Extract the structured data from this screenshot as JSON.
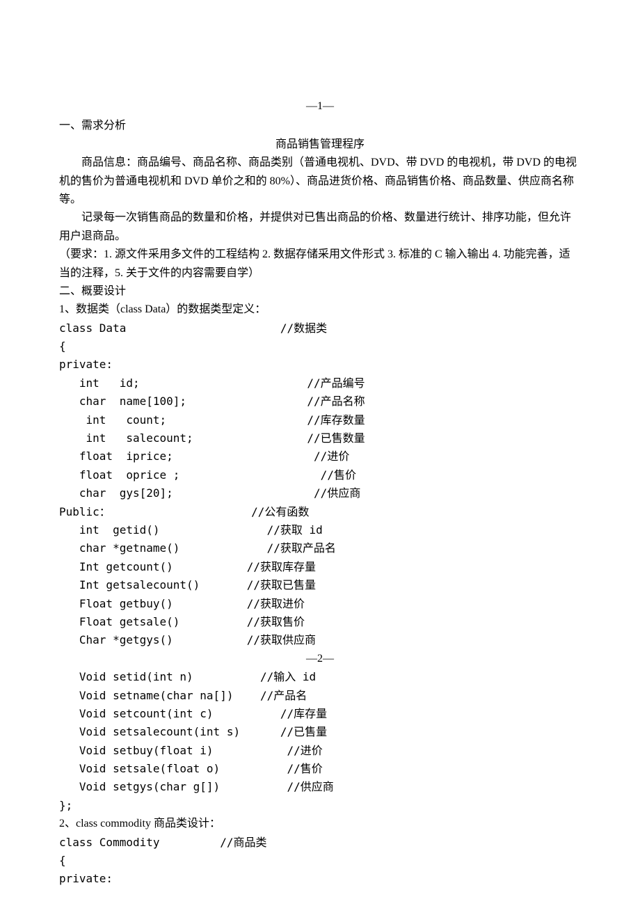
{
  "pageNumTop": "—1—",
  "pageNumMid": "—2—",
  "heading1": "一、需求分析",
  "title": "商品销售管理程序",
  "para1": "商品信息：商品编号、商品名称、商品类别（普通电视机、DVD、带 DVD 的电视机，带 DVD 的电视机的售价为普通电视机和 DVD 单价之和的 80%）、商品进货价格、商品销售价格、商品数量、供应商名称等。",
  "para2": "记录每一次销售商品的数量和价格，并提供对已售出商品的价格、数量进行统计、排序功能，但允许用户退商品。",
  "para3": "（要求：1. 源文件采用多文件的工程结构 2. 数据存储采用文件形式 3. 标准的 C 输入输出 4. 功能完善，适当的注释，5. 关于文件的内容需要自学）",
  "heading2": "二、概要设计",
  "section1": "1、数据类（class  Data）的数据类型定义：",
  "code1a": "class Data                       //数据类\n{\nprivate:\n   int   id;                         //产品编号\n   char  name[100];                  //产品名称\n    int   count;                     //库存数量\n    int   salecount;                 //已售数量\n   float  iprice;                     //进价\n   float  oprice ;                     //售价\n   char  gys[20];                     //供应商\nPublic：                     //公有函数\n   int  getid()                //获取 id\n   char *getname()             //获取产品名\n   Int getcount()           //获取库存量\n   Int getsalecount()       //获取已售量\n   Float getbuy()           //获取进价\n   Float getsale()          //获取售价\n   Char *getgys()           //获取供应商",
  "code1b": "   Void setid(int n)          //输入 id\n   Void setname(char na[])    //产品名\n   Void setcount(int c)          //库存量\n   Void setsalecount(int s)      //已售量\n   Void setbuy(float i)           //进价\n   Void setsale(float o)          //售价\n   Void setgys(char g[])          //供应商\n};",
  "section2": "2、class commodity 商品类设计：",
  "code2": "class Commodity         //商品类\n{\nprivate:"
}
